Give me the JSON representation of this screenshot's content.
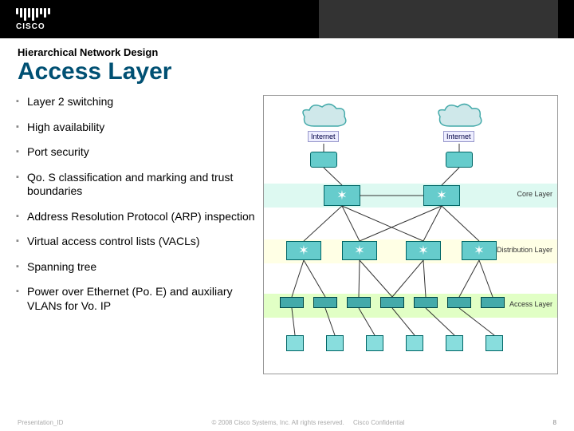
{
  "logo": {
    "text": "CISCO"
  },
  "subtitle": "Hierarchical Network Design",
  "title": "Access Layer",
  "bullets": [
    "Layer 2 switching",
    "High availability",
    "Port security",
    "Qo. S classification and marking and trust boundaries",
    "Address Resolution Protocol (ARP) inspection",
    "Virtual access control lists (VACLs)",
    "Spanning tree",
    "Power over Ethernet (Po. E) and auxiliary VLANs for Vo. IP"
  ],
  "diagram": {
    "internet_left": "Internet",
    "internet_right": "Internet",
    "core_label": "Core Layer",
    "dist_label": "Distribution Layer",
    "access_label": "Access Layer"
  },
  "footer": {
    "left": "Presentation_ID",
    "center": "© 2008 Cisco Systems, Inc. All rights reserved.",
    "confidential": "Cisco Confidential",
    "page": "8"
  }
}
